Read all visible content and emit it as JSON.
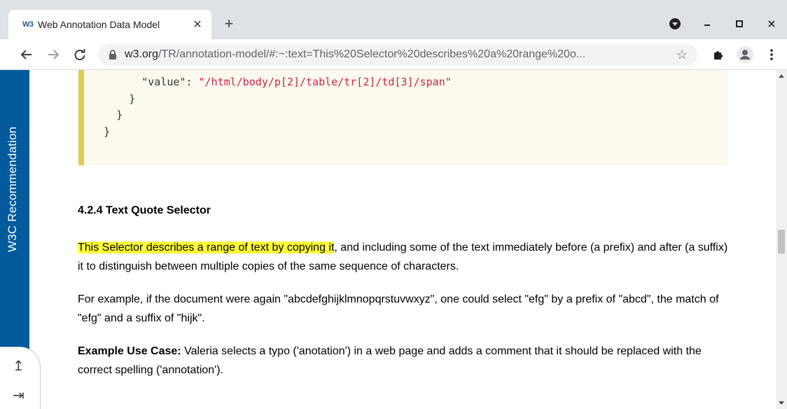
{
  "browser": {
    "tab": {
      "favicon": "W3",
      "title": "Web Annotation Data Model"
    },
    "new_tab_label": "+",
    "url": {
      "host": "w3.org",
      "path": "/TR/annotation-model/#:~:text=This%20Selector%20describes%20a%20range%20o..."
    },
    "icons": {
      "back": "arrow-left-icon",
      "forward": "arrow-right-icon",
      "reload": "reload-icon",
      "lock": "lock-icon",
      "bookmark": "star-icon",
      "extensions": "puzzle-icon",
      "profile": "avatar-icon",
      "menu": "kebab-menu-icon",
      "media": "media-record-icon",
      "minimize": "minimize-icon",
      "maximize": "maximize-icon",
      "close": "close-icon"
    }
  },
  "sidebar": {
    "label": "W3C Recommendation",
    "color": "#005a9c",
    "up_arrow": "↥",
    "right_arrow": "⇥"
  },
  "code": {
    "line1_key": "\"value\"",
    "line1_sep": ": ",
    "line1_value": "\"/html/body/p[2]/table/tr[2]/td[3]/span\"",
    "line2": "}",
    "line3": "}",
    "line4": "}"
  },
  "section": {
    "heading": "4.2.4 Text Quote Selector",
    "p1_highlight": "This Selector describes a range of text by copying it",
    "p1_rest": ", and including some of the text immediately before (a prefix) and after (a suffix) it to distinguish between multiple copies of the same sequence of characters.",
    "p2": "For example, if the document were again \"abcdefghijklmnopqrstuvwxyz\", one could select \"efg\" by a prefix of \"abcd\", the match of \"efg\" and a suffix of \"hijk\".",
    "p3_label": "Example Use Case:",
    "p3_rest": " Valeria selects a typo ('anotation') in a web page and adds a comment that it should be replaced with the correct spelling ('annotation')."
  },
  "colors": {
    "highlight": "#ffff38",
    "code_border": "#e0cb52",
    "code_bg": "#fcfaee",
    "code_string": "#c7254e"
  }
}
